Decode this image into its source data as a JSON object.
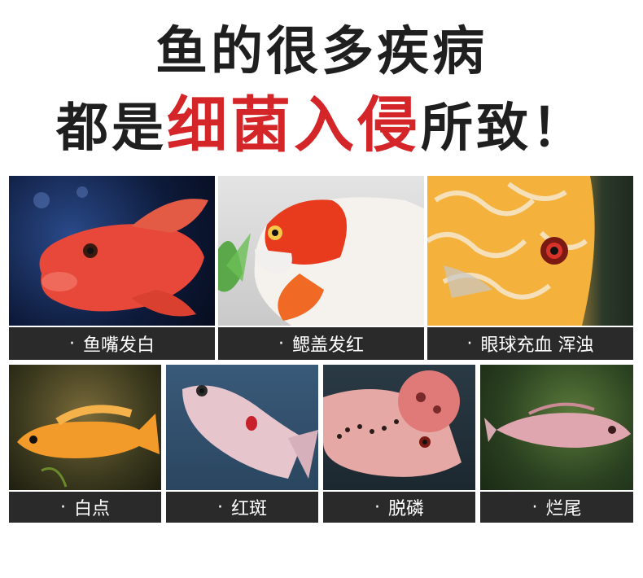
{
  "headline": {
    "line1": "鱼的很多疾病",
    "line2_prefix": "都是",
    "line2_highlight": "细菌入侵",
    "line2_suffix": "所致！"
  },
  "bullet": "·",
  "tiles": [
    {
      "label": "鱼嘴发白"
    },
    {
      "label": "鳃盖发红"
    },
    {
      "label": "眼球充血 浑浊"
    },
    {
      "label": "白点"
    },
    {
      "label": "红斑"
    },
    {
      "label": "脱磷"
    },
    {
      "label": "烂尾"
    }
  ],
  "colors": {
    "headline": "#1f1f1f",
    "highlight": "#d42528",
    "caption_bg": "#2a2a2a",
    "caption_text": "#ffffff"
  }
}
